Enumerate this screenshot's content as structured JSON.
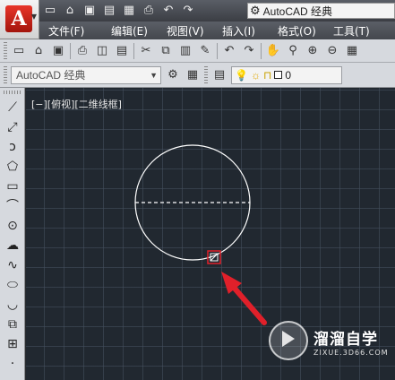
{
  "window": {
    "workspace_title": "AutoCAD 经典"
  },
  "menubar": {
    "items": [
      "文件(F)",
      "编辑(E)",
      "视图(V)",
      "插入(I)",
      "格式(O)",
      "工具(T)"
    ]
  },
  "toolbar2": {
    "workspace_combo": "AutoCAD 经典",
    "layer_value": "0"
  },
  "viewport": {
    "label": "[−][俯视][二维线框]"
  },
  "watermark": {
    "brand": "溜溜自学",
    "url": "ZIXUE.3D66.COM"
  },
  "colors": {
    "highlight_box": "#e0202a",
    "arrow": "#e0202a",
    "geometry": "#ffffff",
    "layer_bulb": "#f2c500"
  },
  "icons": {
    "app": "autocad-logo-icon",
    "quick_access": [
      "new-icon",
      "open-icon",
      "save-icon",
      "saveas-icon",
      "plot-icon",
      "undo-icon",
      "redo-icon"
    ],
    "draw_tools": [
      "line-icon",
      "construction-line-icon",
      "polyline-icon",
      "polygon-icon",
      "rectangle-icon",
      "arc-icon",
      "circle-icon",
      "revision-cloud-icon",
      "spline-icon",
      "ellipse-icon",
      "ellipse-arc-icon",
      "insert-block-icon",
      "make-block-icon",
      "point-icon"
    ]
  }
}
